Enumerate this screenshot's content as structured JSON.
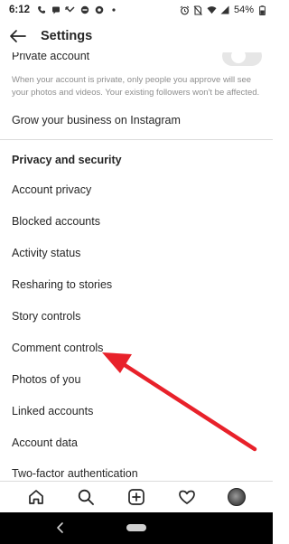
{
  "status_bar": {
    "time": "6:12",
    "left_icons": [
      "phone-icon",
      "message-icon",
      "missed-call-icon",
      "dnd-icon",
      "chrome-icon",
      "dot-icon"
    ],
    "right_icons": [
      "alarm-icon",
      "no-sim-icon",
      "wifi-icon",
      "signal-icon"
    ],
    "battery": "54%"
  },
  "header": {
    "title": "Settings"
  },
  "private_account": {
    "label": "Private account",
    "enabled": false,
    "description": "When your account is private, only people you approve will see your photos and videos. Your existing followers won't be affected."
  },
  "grow_business": "Grow your business on Instagram",
  "section_title": "Privacy and security",
  "menu_items": [
    {
      "label": "Account privacy"
    },
    {
      "label": "Blocked accounts"
    },
    {
      "label": "Activity status"
    },
    {
      "label": "Resharing to stories"
    },
    {
      "label": "Story controls"
    },
    {
      "label": "Comment controls"
    },
    {
      "label": "Photos of you"
    },
    {
      "label": "Linked accounts"
    },
    {
      "label": "Account data"
    },
    {
      "label": "Two-factor authentication"
    }
  ],
  "annotation": {
    "color": "#e8212a"
  },
  "bottom_nav": {
    "icons": [
      "home-icon",
      "search-icon",
      "add-post-icon",
      "heart-icon",
      "profile-avatar"
    ]
  }
}
